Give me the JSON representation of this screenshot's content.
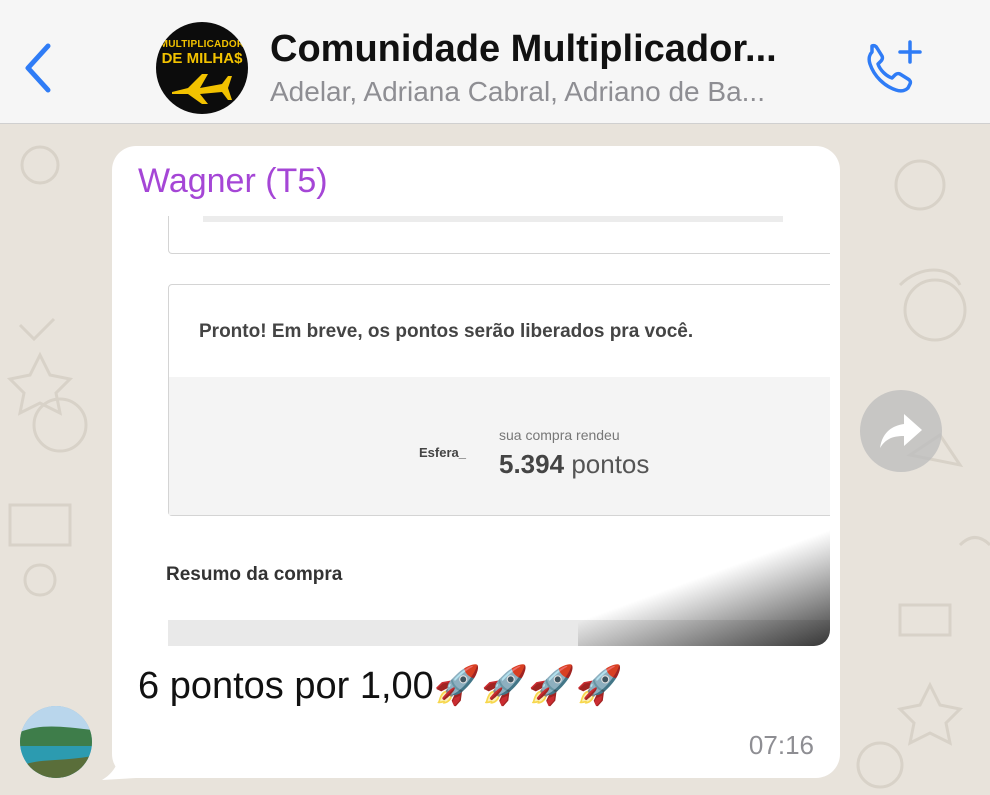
{
  "header": {
    "title": "Comunidade Multiplicador...",
    "members": "Adelar, Adriana Cabral, Adriano de Ba...",
    "avatar_line1": "MULTIPLICADOR",
    "avatar_line2": "DE MILHA$"
  },
  "message": {
    "sender": "Wagner (T5)",
    "image": {
      "confirmation_text": "Pronto! Em breve, os pontos serão liberados pra você.",
      "brand_label": "Esfera_",
      "earned_label": "sua compra rendeu",
      "points_value": "5.394",
      "points_unit": "pontos",
      "summary_heading": "Resumo da compra"
    },
    "caption": "6 pontos por 1,00🚀🚀🚀🚀",
    "time": "07:16"
  },
  "colors": {
    "accent_blue": "#2f7cf6",
    "sender_purple": "#a546d6",
    "avatar_gold": "#f2c200"
  },
  "icons": {
    "back": "chevron-left-icon",
    "call": "phone-add-icon",
    "forward": "forward-arrow-icon"
  }
}
